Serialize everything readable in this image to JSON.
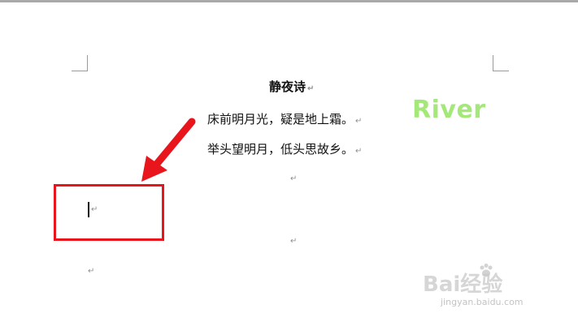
{
  "document": {
    "title": "静夜诗",
    "lines": [
      "床前明月光，疑是地上霜。",
      "举头望明月，低头思故乡。"
    ],
    "paragraph_mark": "↵"
  },
  "watermark": {
    "text": "River",
    "color": "#a4e87a"
  },
  "annotation": {
    "highlight_color": "#e8161c",
    "arrow_color": "#e8161c"
  },
  "baidu": {
    "logo_text": "Bai经验",
    "url": "jingyan.baidu.com"
  }
}
